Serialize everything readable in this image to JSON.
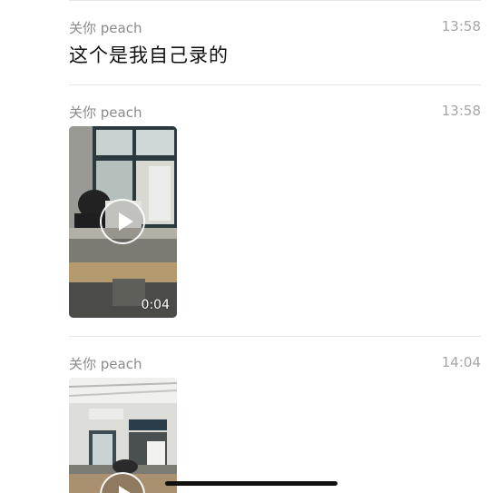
{
  "messages": [
    {
      "sender": "关你 peach",
      "time": "13:58",
      "text": "这个是我自己录的"
    },
    {
      "sender": "关你 peach",
      "time": "13:58",
      "video": {
        "duration": "0:04"
      }
    },
    {
      "sender": "关你 peach",
      "time": "14:04",
      "video": {
        "duration": ""
      }
    }
  ],
  "colors": {
    "divider": "#e6e6e6",
    "sender": "#8a8a8a",
    "time": "#a6a6a6"
  },
  "icons": [
    "play-icon",
    "home-indicator"
  ]
}
